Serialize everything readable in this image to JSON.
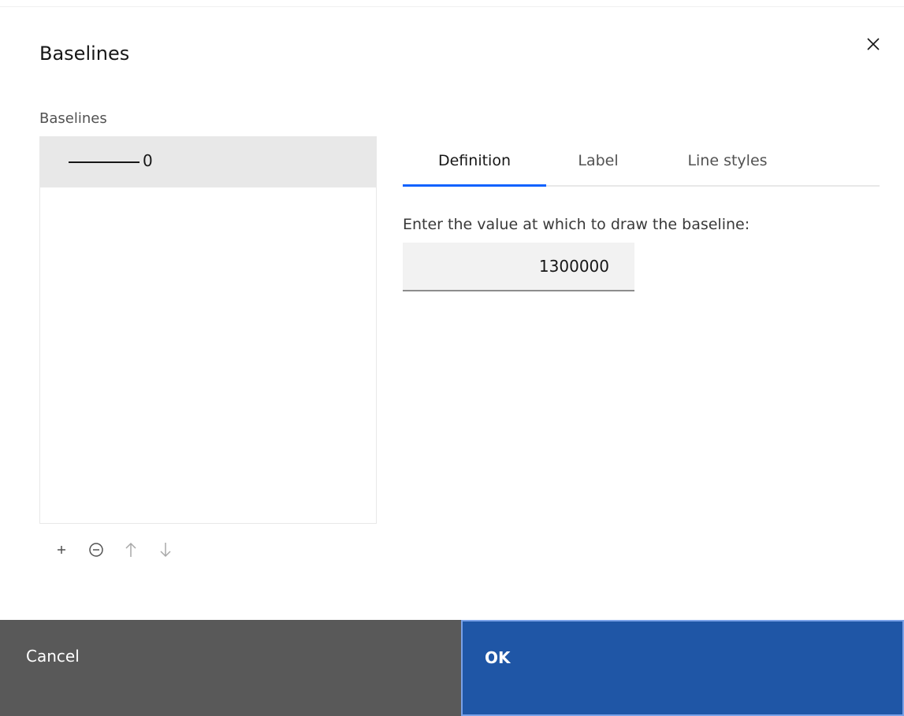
{
  "dialog": {
    "title": "Baselines",
    "close_icon": "close-icon"
  },
  "baselines_list": {
    "caption": "Baselines",
    "items": [
      {
        "label": "0",
        "selected": true
      }
    ],
    "toolbar": {
      "add_icon": "plus-icon",
      "remove_icon": "minus-circle-icon",
      "move_up_icon": "arrow-up-icon",
      "move_down_icon": "arrow-down-icon"
    }
  },
  "tabs": [
    {
      "label": "Definition",
      "active": true
    },
    {
      "label": "Label",
      "active": false
    },
    {
      "label": "Line styles",
      "active": false
    }
  ],
  "definition": {
    "field_label": "Enter the value at which to draw the baseline:",
    "value": "1300000"
  },
  "footer": {
    "cancel_label": "Cancel",
    "ok_label": "OK"
  },
  "colors": {
    "primary": "#1f56a6",
    "secondary": "#595959",
    "tab_indicator": "#0f62fe",
    "selected_row": "#e8e8e8"
  }
}
